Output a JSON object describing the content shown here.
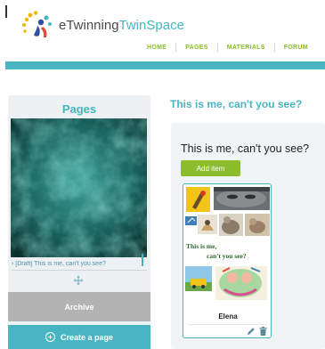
{
  "header": {
    "brand_prefix": "eTwinning",
    "brand_suffix": "TwinSpace",
    "nav": [
      {
        "label": "HOME"
      },
      {
        "label": "PAGES"
      },
      {
        "label": "MATERIALS"
      },
      {
        "label": "FORUM"
      }
    ]
  },
  "sidebar": {
    "title": "Pages",
    "page_link": "› [Draft] This is me, can't you see?",
    "archive_label": "Archive",
    "create_label": "Create a page"
  },
  "main": {
    "page_title": "This is me, can't you see?",
    "panel_title": "This is me, can't you see?",
    "add_item_label": "Add item",
    "card": {
      "name": "Elena",
      "collage_caption_line1": "This is me,",
      "collage_caption_line2": "can't you see?"
    }
  },
  "colors": {
    "accent_teal": "#48b6c2",
    "accent_green": "#8bbd2d",
    "archive_gray": "#b3b3b3",
    "panel_bg": "#f0f4f6"
  },
  "icons": [
    "etwinning-logo-icon",
    "move-icon",
    "plus-circle-icon",
    "edit-icon",
    "trash-icon"
  ]
}
